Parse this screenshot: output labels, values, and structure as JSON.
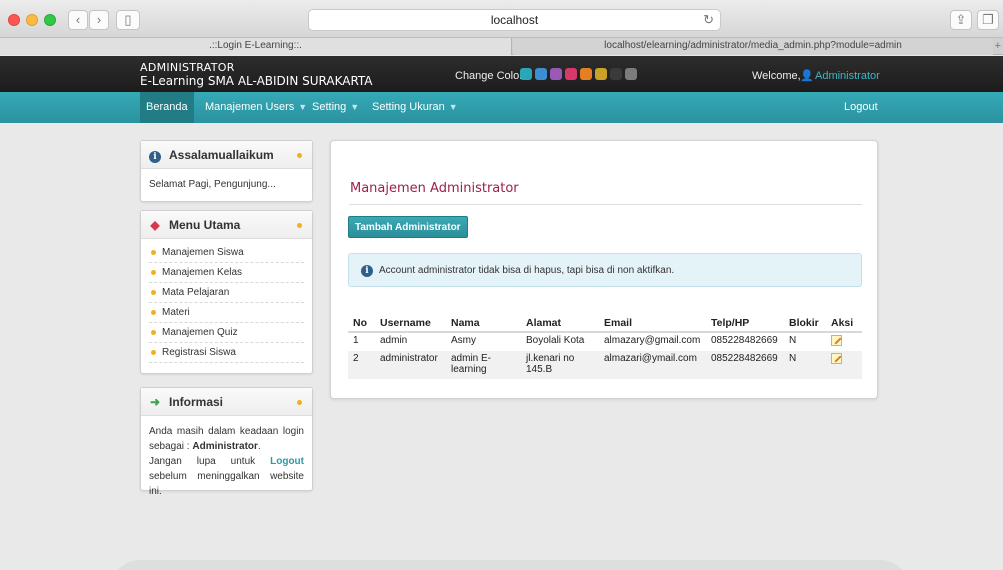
{
  "browser": {
    "address": "localhost",
    "tabs": [
      ".::Login E-Learning::.",
      "localhost/elearning/administrator/media_admin.php?module=admin"
    ]
  },
  "header": {
    "role": "ADMINISTRATOR",
    "school": "E-Learning SMA AL-ABIDIN SURAKARTA",
    "change_color_label": "Change Color",
    "swatches": [
      "#2ba6b7",
      "#3d8fd1",
      "#9b59b6",
      "#d9386b",
      "#e67e22",
      "#c9a227",
      "#3a3a3a",
      "#7c7c7c"
    ],
    "welcome_label": "Welcome,",
    "user": "Administrator"
  },
  "nav": {
    "items": [
      "Beranda",
      "Manajemen Users",
      "Setting",
      "Setting Ukuran"
    ],
    "logout": "Logout"
  },
  "sidebar": {
    "greeting_title": "Assalamuallaikum",
    "greeting_text": "Selamat Pagi, Pengunjung...",
    "menu_title": "Menu Utama",
    "menu_items": [
      "Manajemen Siswa",
      "Manajemen Kelas",
      "Mata Pelajaran",
      "Materi",
      "Manajemen Quiz",
      "Registrasi Siswa"
    ],
    "info_title": "Informasi",
    "info_p1": "Anda masih dalam keadaan login sebagai :",
    "info_role": "Administrator",
    "info_p2a": "Jangan lupa untuk",
    "info_logout": "Logout",
    "info_p2b": "sebelum meninggalkan website ini."
  },
  "main": {
    "title": "Manajemen Administrator",
    "add_button": "Tambah Administrator",
    "info_message": "Account administrator tidak bisa di hapus, tapi bisa di non aktifkan.",
    "columns": [
      "No",
      "Username",
      "Nama",
      "Alamat",
      "Email",
      "Telp/HP",
      "Blokir",
      "Aksi"
    ],
    "rows": [
      {
        "no": "1",
        "username": "admin",
        "nama": "Asmy",
        "alamat": "Boyolali Kota",
        "email": "almazary@gmail.com",
        "telp": "085228482669",
        "blokir": "N"
      },
      {
        "no": "2",
        "username": "administrator",
        "nama": "admin E-learning",
        "alamat": "jl.kenari no 145.B",
        "email": "almazari@ymail.com",
        "telp": "085228482669",
        "blokir": "N"
      }
    ]
  }
}
